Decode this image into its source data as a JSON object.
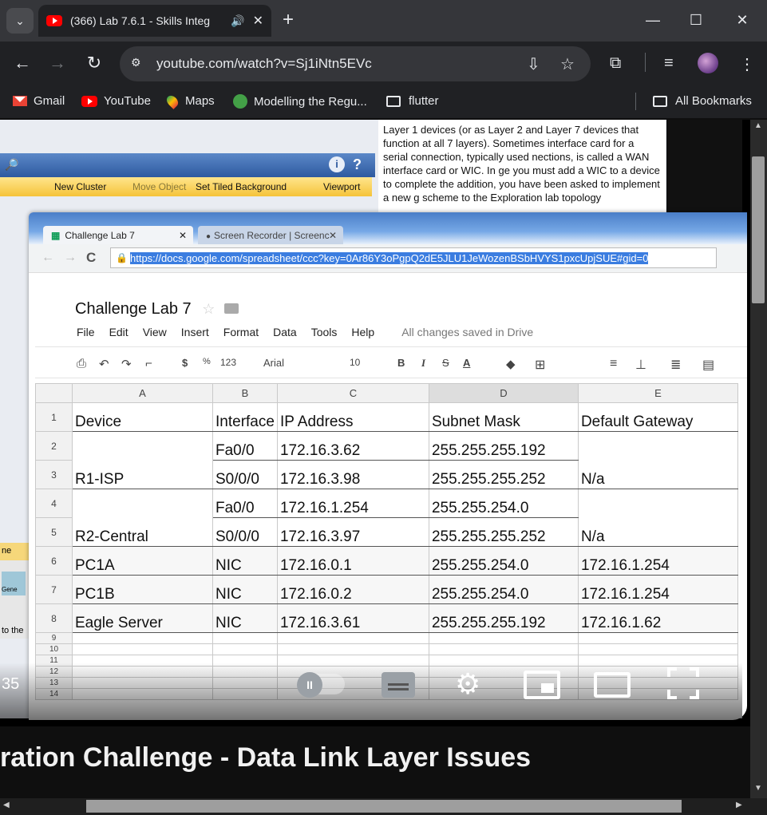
{
  "browser": {
    "tab_title": "(366) Lab 7.6.1 - Skills Integ",
    "tab_audio_icon": "speaker-icon",
    "url": "youtube.com/watch?v=Sj1iNtn5EVc",
    "bookmarks": [
      {
        "label": "Gmail"
      },
      {
        "label": "YouTube"
      },
      {
        "label": "Maps"
      },
      {
        "label": "Modelling the Regu..."
      },
      {
        "label": "flutter"
      }
    ],
    "all_bookmarks": "All Bookmarks"
  },
  "video": {
    "pt_toolbar": [
      "New Cluster",
      "Move Object",
      "Set Tiled Background",
      "Viewport"
    ],
    "pt_text": "Layer 1 devices (or as Layer 2 and Layer 7 devices that function at all 7 layers). Sometimes interface card for a serial connection, typically used nections, is called a WAN interface card or WIC. In ge you must add a WIC to a device to complete the addition, you have been asked to implement a new g scheme to the Exploration lab topology",
    "side_labels": [
      "ne",
      "Gene",
      "to the"
    ],
    "sheet_tabs": [
      "Challenge Lab 7",
      "Screen Recorder | Screenc"
    ],
    "sheet_url": "https://docs.google.com/spreadsheet/ccc?key=0Ar86Y3oPgpQ2dE5JLU1JeWozenBSbHVYS1pxcUpjSUE#gid=0",
    "doc_title": "Challenge Lab 7",
    "menu": [
      "File",
      "Edit",
      "View",
      "Insert",
      "Format",
      "Data",
      "Tools",
      "Help"
    ],
    "saved_status": "All changes saved in Drive",
    "format_bar": {
      "currency": "$",
      "percent": "%",
      "number": "123",
      "font": "Arial",
      "size": "10",
      "bold": "B",
      "italic": "I",
      "strike": "S",
      "color": "A"
    },
    "columns": [
      "A",
      "B",
      "C",
      "D",
      "E"
    ],
    "rows": [
      {
        "n": "1",
        "cells": [
          "Device",
          "Interface",
          "IP Address",
          "Subnet Mask",
          "Default Gateway"
        ]
      },
      {
        "n": "2",
        "cells": [
          "",
          "Fa0/0",
          "172.16.3.62",
          "255.255.255.192",
          ""
        ]
      },
      {
        "n": "3",
        "cells": [
          "R1-ISP",
          "S0/0/0",
          "172.16.3.98",
          "255.255.255.252",
          "N/a"
        ]
      },
      {
        "n": "4",
        "cells": [
          "",
          "Fa0/0",
          "172.16.1.254",
          "255.255.254.0",
          ""
        ]
      },
      {
        "n": "5",
        "cells": [
          "R2-Central",
          "S0/0/0",
          "172.16.3.97",
          "255.255.255.252",
          "N/a"
        ]
      },
      {
        "n": "6",
        "cells": [
          "PC1A",
          "NIC",
          "172.16.0.1",
          "255.255.254.0",
          "172.16.1.254"
        ]
      },
      {
        "n": "7",
        "cells": [
          "PC1B",
          "NIC",
          "172.16.0.2",
          "255.255.254.0",
          "172.16.1.254"
        ]
      },
      {
        "n": "8",
        "cells": [
          "Eagle Server",
          "NIC",
          "172.16.3.61",
          "255.255.255.192",
          "172.16.1.62"
        ]
      }
    ],
    "empty_rows": [
      "9",
      "10",
      "11",
      "12",
      "13",
      "14"
    ],
    "player_time": "35"
  },
  "title": "ration Challenge - Data Link Layer Issues"
}
